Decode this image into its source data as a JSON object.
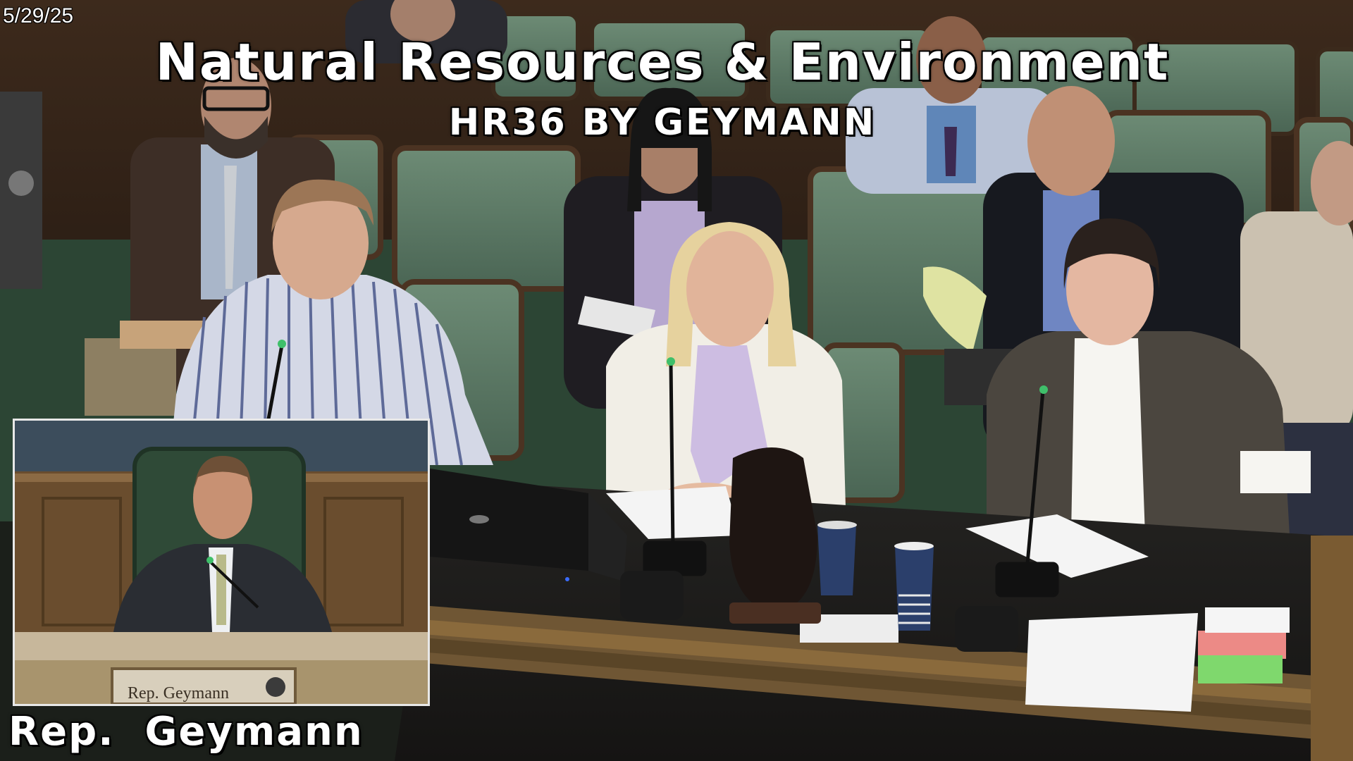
{
  "broadcast": {
    "date": "5/29/25",
    "committee_title": "Natural Resources & Environment",
    "bill_subtitle": "HR36 BY GEYMANN",
    "speaker_caption": "Rep.  Geymann"
  },
  "scene": {
    "setting": "legislative committee room",
    "seat_color": "#5f7a66",
    "wall_color": "#4a3322",
    "desk_color": "#1e1d1b",
    "desk_trim_color": "#8a6a3c",
    "carpet_color": "#2f4a37"
  },
  "pip": {
    "setting": "chairman's bench",
    "nameplate_text": "Rep. Geymann"
  }
}
